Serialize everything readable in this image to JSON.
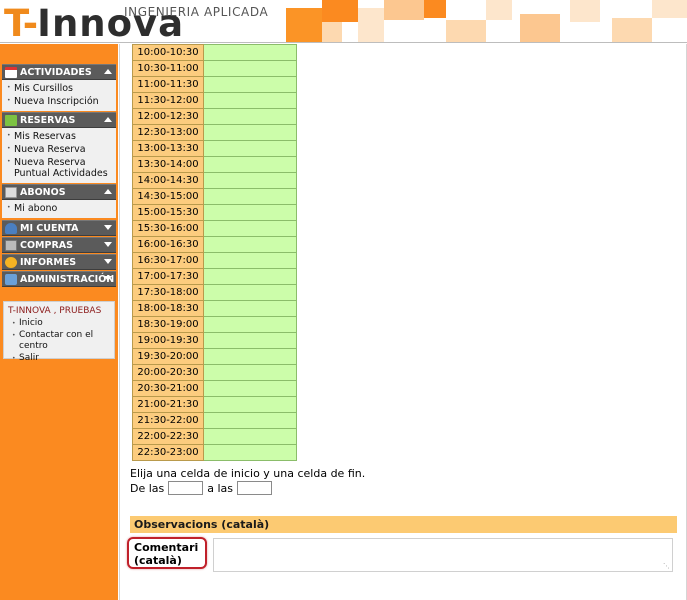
{
  "header": {
    "logo_main": "T-",
    "logo_innova": "Innova",
    "logo_subtitle": "INGENIERIA APLICADA",
    "colors": {
      "orange": "#f08a1c",
      "dark": "#2e2e2e"
    }
  },
  "sidebar": {
    "menus": [
      {
        "title": "ACTIVIDADES",
        "icon": "calendar-icon",
        "expanded": true,
        "items": [
          "Mis Cursillos",
          "Nueva Inscripción"
        ]
      },
      {
        "title": "RESERVAS",
        "icon": "grid-icon",
        "expanded": true,
        "items": [
          "Mis Reservas",
          "Nueva Reserva",
          "Nueva Reserva Puntual Actividades"
        ]
      },
      {
        "title": "ABONOS",
        "icon": "card-icon",
        "expanded": true,
        "items": [
          "Mi abono"
        ]
      },
      {
        "title": "MI CUENTA",
        "icon": "user-icon",
        "expanded": false,
        "items": []
      },
      {
        "title": "COMPRAS",
        "icon": "cart-icon",
        "expanded": false,
        "items": []
      },
      {
        "title": "INFORMES",
        "icon": "globe-icon",
        "expanded": false,
        "items": []
      },
      {
        "title": "ADMINISTRACIÓN",
        "icon": "tools-icon",
        "expanded": false,
        "items": []
      }
    ],
    "user_box": {
      "name": "T-INNOVA , PRUEBAS",
      "links": [
        "Inicio",
        "Contactar con el centro",
        "Salir"
      ]
    }
  },
  "slots": [
    "10:00-10:30",
    "10:30-11:00",
    "11:00-11:30",
    "11:30-12:00",
    "12:00-12:30",
    "12:30-13:00",
    "13:00-13:30",
    "13:30-14:00",
    "14:00-14:30",
    "14:30-15:00",
    "15:00-15:30",
    "15:30-16:00",
    "16:00-16:30",
    "16:30-17:00",
    "17:00-17:30",
    "17:30-18:00",
    "18:00-18:30",
    "18:30-19:00",
    "19:00-19:30",
    "19:30-20:00",
    "20:00-20:30",
    "20:30-21:00",
    "21:00-21:30",
    "21:30-22:00",
    "22:00-22:30",
    "22:30-23:00"
  ],
  "form": {
    "instructions": "Elija una celda de inicio y una celda de fin.",
    "from_label": "De las",
    "to_label": "a las",
    "from_value": "",
    "to_value": ""
  },
  "observations": {
    "section_title": "Observacions (català)",
    "comment_label_line1": "Comentari",
    "comment_label_line2": "(català)",
    "comment_value": ""
  }
}
